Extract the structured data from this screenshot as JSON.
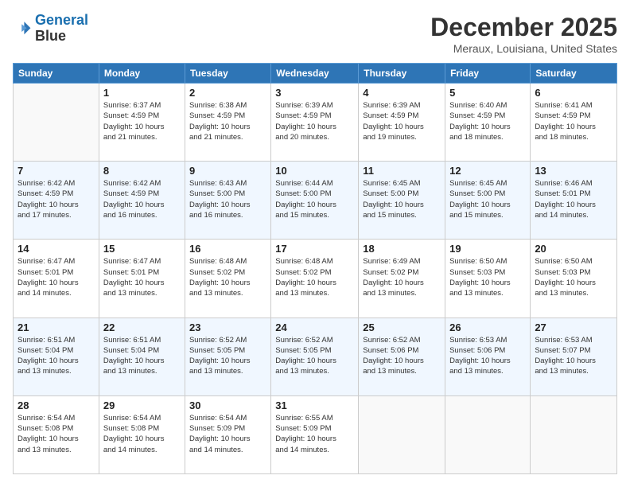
{
  "logo": {
    "line1": "General",
    "line2": "Blue"
  },
  "header": {
    "month_year": "December 2025",
    "location": "Meraux, Louisiana, United States"
  },
  "days_of_week": [
    "Sunday",
    "Monday",
    "Tuesday",
    "Wednesday",
    "Thursday",
    "Friday",
    "Saturday"
  ],
  "weeks": [
    [
      {
        "day": "",
        "info": ""
      },
      {
        "day": "1",
        "info": "Sunrise: 6:37 AM\nSunset: 4:59 PM\nDaylight: 10 hours\nand 21 minutes."
      },
      {
        "day": "2",
        "info": "Sunrise: 6:38 AM\nSunset: 4:59 PM\nDaylight: 10 hours\nand 21 minutes."
      },
      {
        "day": "3",
        "info": "Sunrise: 6:39 AM\nSunset: 4:59 PM\nDaylight: 10 hours\nand 20 minutes."
      },
      {
        "day": "4",
        "info": "Sunrise: 6:39 AM\nSunset: 4:59 PM\nDaylight: 10 hours\nand 19 minutes."
      },
      {
        "day": "5",
        "info": "Sunrise: 6:40 AM\nSunset: 4:59 PM\nDaylight: 10 hours\nand 18 minutes."
      },
      {
        "day": "6",
        "info": "Sunrise: 6:41 AM\nSunset: 4:59 PM\nDaylight: 10 hours\nand 18 minutes."
      }
    ],
    [
      {
        "day": "7",
        "info": "Sunrise: 6:42 AM\nSunset: 4:59 PM\nDaylight: 10 hours\nand 17 minutes."
      },
      {
        "day": "8",
        "info": "Sunrise: 6:42 AM\nSunset: 4:59 PM\nDaylight: 10 hours\nand 16 minutes."
      },
      {
        "day": "9",
        "info": "Sunrise: 6:43 AM\nSunset: 5:00 PM\nDaylight: 10 hours\nand 16 minutes."
      },
      {
        "day": "10",
        "info": "Sunrise: 6:44 AM\nSunset: 5:00 PM\nDaylight: 10 hours\nand 15 minutes."
      },
      {
        "day": "11",
        "info": "Sunrise: 6:45 AM\nSunset: 5:00 PM\nDaylight: 10 hours\nand 15 minutes."
      },
      {
        "day": "12",
        "info": "Sunrise: 6:45 AM\nSunset: 5:00 PM\nDaylight: 10 hours\nand 15 minutes."
      },
      {
        "day": "13",
        "info": "Sunrise: 6:46 AM\nSunset: 5:01 PM\nDaylight: 10 hours\nand 14 minutes."
      }
    ],
    [
      {
        "day": "14",
        "info": "Sunrise: 6:47 AM\nSunset: 5:01 PM\nDaylight: 10 hours\nand 14 minutes."
      },
      {
        "day": "15",
        "info": "Sunrise: 6:47 AM\nSunset: 5:01 PM\nDaylight: 10 hours\nand 13 minutes."
      },
      {
        "day": "16",
        "info": "Sunrise: 6:48 AM\nSunset: 5:02 PM\nDaylight: 10 hours\nand 13 minutes."
      },
      {
        "day": "17",
        "info": "Sunrise: 6:48 AM\nSunset: 5:02 PM\nDaylight: 10 hours\nand 13 minutes."
      },
      {
        "day": "18",
        "info": "Sunrise: 6:49 AM\nSunset: 5:02 PM\nDaylight: 10 hours\nand 13 minutes."
      },
      {
        "day": "19",
        "info": "Sunrise: 6:50 AM\nSunset: 5:03 PM\nDaylight: 10 hours\nand 13 minutes."
      },
      {
        "day": "20",
        "info": "Sunrise: 6:50 AM\nSunset: 5:03 PM\nDaylight: 10 hours\nand 13 minutes."
      }
    ],
    [
      {
        "day": "21",
        "info": "Sunrise: 6:51 AM\nSunset: 5:04 PM\nDaylight: 10 hours\nand 13 minutes."
      },
      {
        "day": "22",
        "info": "Sunrise: 6:51 AM\nSunset: 5:04 PM\nDaylight: 10 hours\nand 13 minutes."
      },
      {
        "day": "23",
        "info": "Sunrise: 6:52 AM\nSunset: 5:05 PM\nDaylight: 10 hours\nand 13 minutes."
      },
      {
        "day": "24",
        "info": "Sunrise: 6:52 AM\nSunset: 5:05 PM\nDaylight: 10 hours\nand 13 minutes."
      },
      {
        "day": "25",
        "info": "Sunrise: 6:52 AM\nSunset: 5:06 PM\nDaylight: 10 hours\nand 13 minutes."
      },
      {
        "day": "26",
        "info": "Sunrise: 6:53 AM\nSunset: 5:06 PM\nDaylight: 10 hours\nand 13 minutes."
      },
      {
        "day": "27",
        "info": "Sunrise: 6:53 AM\nSunset: 5:07 PM\nDaylight: 10 hours\nand 13 minutes."
      }
    ],
    [
      {
        "day": "28",
        "info": "Sunrise: 6:54 AM\nSunset: 5:08 PM\nDaylight: 10 hours\nand 13 minutes."
      },
      {
        "day": "29",
        "info": "Sunrise: 6:54 AM\nSunset: 5:08 PM\nDaylight: 10 hours\nand 14 minutes."
      },
      {
        "day": "30",
        "info": "Sunrise: 6:54 AM\nSunset: 5:09 PM\nDaylight: 10 hours\nand 14 minutes."
      },
      {
        "day": "31",
        "info": "Sunrise: 6:55 AM\nSunset: 5:09 PM\nDaylight: 10 hours\nand 14 minutes."
      },
      {
        "day": "",
        "info": ""
      },
      {
        "day": "",
        "info": ""
      },
      {
        "day": "",
        "info": ""
      }
    ]
  ]
}
